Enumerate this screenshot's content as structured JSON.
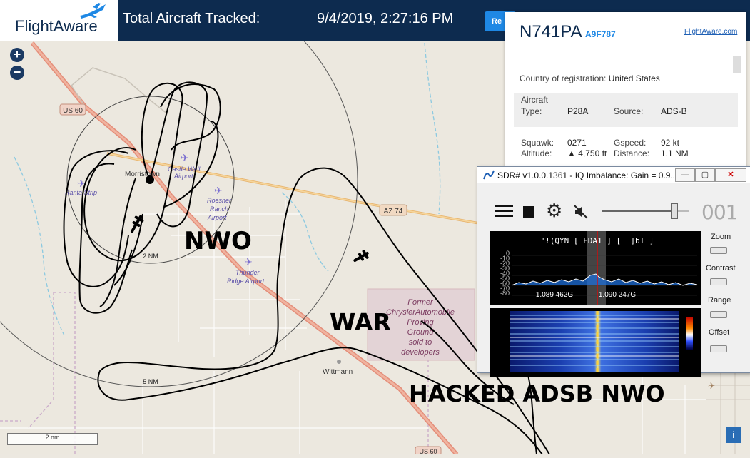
{
  "topbar": {
    "logo_text": "FlightAware",
    "tracked_label": "Total Aircraft Tracked:",
    "datetime": "9/4/2019, 2:27:16 PM",
    "button_label": "Re"
  },
  "map": {
    "road_labels": [
      "US 60",
      "AZ 74",
      "US 60"
    ],
    "places": [
      "Morristown",
      "Wittmann"
    ],
    "airports": [
      "Castle Well Airport",
      "Roesner Ranch Airport",
      "Thunder Ridge Airport",
      "Ranta Strip"
    ],
    "area_label": [
      "Former",
      "ChryslerAutomobile",
      "Proving",
      "Ground",
      "sold to",
      "developers"
    ],
    "range_rings": [
      "2 NM",
      "5 NM"
    ],
    "scale": "2 nm"
  },
  "overlay_text": {
    "nwo": "NWO",
    "war": "WAR",
    "hacked": "HACKED ADSB NWO"
  },
  "aircraft_panel": {
    "tail": "N741PA",
    "hex": "A9F787",
    "link": "FlightAware.com",
    "country_label": "Country of registration:",
    "country": "United States",
    "aircraft_label": "Aircraft",
    "type_label": "Type:",
    "type": "P28A",
    "source_label": "Source:",
    "source": "ADS-B",
    "squawk_label": "Squawk:",
    "squawk": "0271",
    "gspeed_label": "Gspeed:",
    "gspeed": "92 kt",
    "altitude_label": "Altitude:",
    "altitude": "▲ 4,750 ft",
    "distance_label": "Distance:",
    "distance": "1.1 NM"
  },
  "sdr": {
    "title": "SDR# v1.0.0.1361 - IQ Imbalance: Gain = 0.9...",
    "counter": "001",
    "spectrum_text": "\"!(QYN [ FDA1 ]  [ _]bT ]",
    "db_ticks": [
      "0",
      "-10",
      "-20",
      "-30",
      "-40",
      "-50",
      "-60",
      "-70",
      "-80"
    ],
    "freq_left": "1.089 462G",
    "freq_right": "1.090 247G",
    "controls": [
      "Zoom",
      "Contrast",
      "Range",
      "Offset"
    ],
    "volume_level": 0.82
  },
  "info_label": "i"
}
